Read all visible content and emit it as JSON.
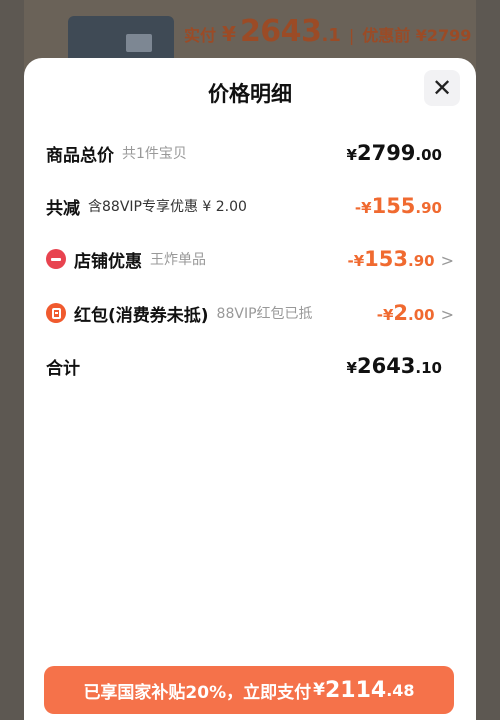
{
  "background": {
    "paid_label": "实付",
    "currency": "¥",
    "paid_int": "2643",
    "paid_frac": ".1",
    "separator": "|",
    "original_label": "优惠前 ¥2799"
  },
  "sheet": {
    "title": "价格明细",
    "close_icon": "close-icon"
  },
  "rows": {
    "total_goods": {
      "label": "商品总价",
      "sub": "共1件宝贝",
      "currency": "¥",
      "int": "2799",
      "dec": ".00"
    },
    "discount_total": {
      "label": "共减",
      "sub": "含88VIP专享优惠 ¥ 2.00",
      "currency": "-¥",
      "int": "155",
      "dec": ".90"
    },
    "shop_discount": {
      "icon": "shop-coupon-icon",
      "label": "店铺优惠",
      "sub": "王炸单品",
      "currency": "-¥",
      "int": "153",
      "dec": ".90",
      "chevron": ">"
    },
    "red_packet": {
      "icon": "red-packet-icon",
      "label": "红包(消费券未抵)",
      "sub": "88VIP红包已抵",
      "currency": "-¥",
      "int": "2",
      "dec": ".00",
      "chevron": ">"
    },
    "sum": {
      "label": "合计",
      "currency": "¥",
      "int": "2643",
      "dec": ".10"
    }
  },
  "pay_button": {
    "text": "已享国家补贴20%，立即支付",
    "currency": "¥",
    "int": "2114",
    "dec": ".48"
  },
  "colors": {
    "accent_orange": "#f06a30",
    "button": "#f5724a",
    "shop_icon": "#e8434f",
    "packet_icon": "#f05a2e"
  }
}
